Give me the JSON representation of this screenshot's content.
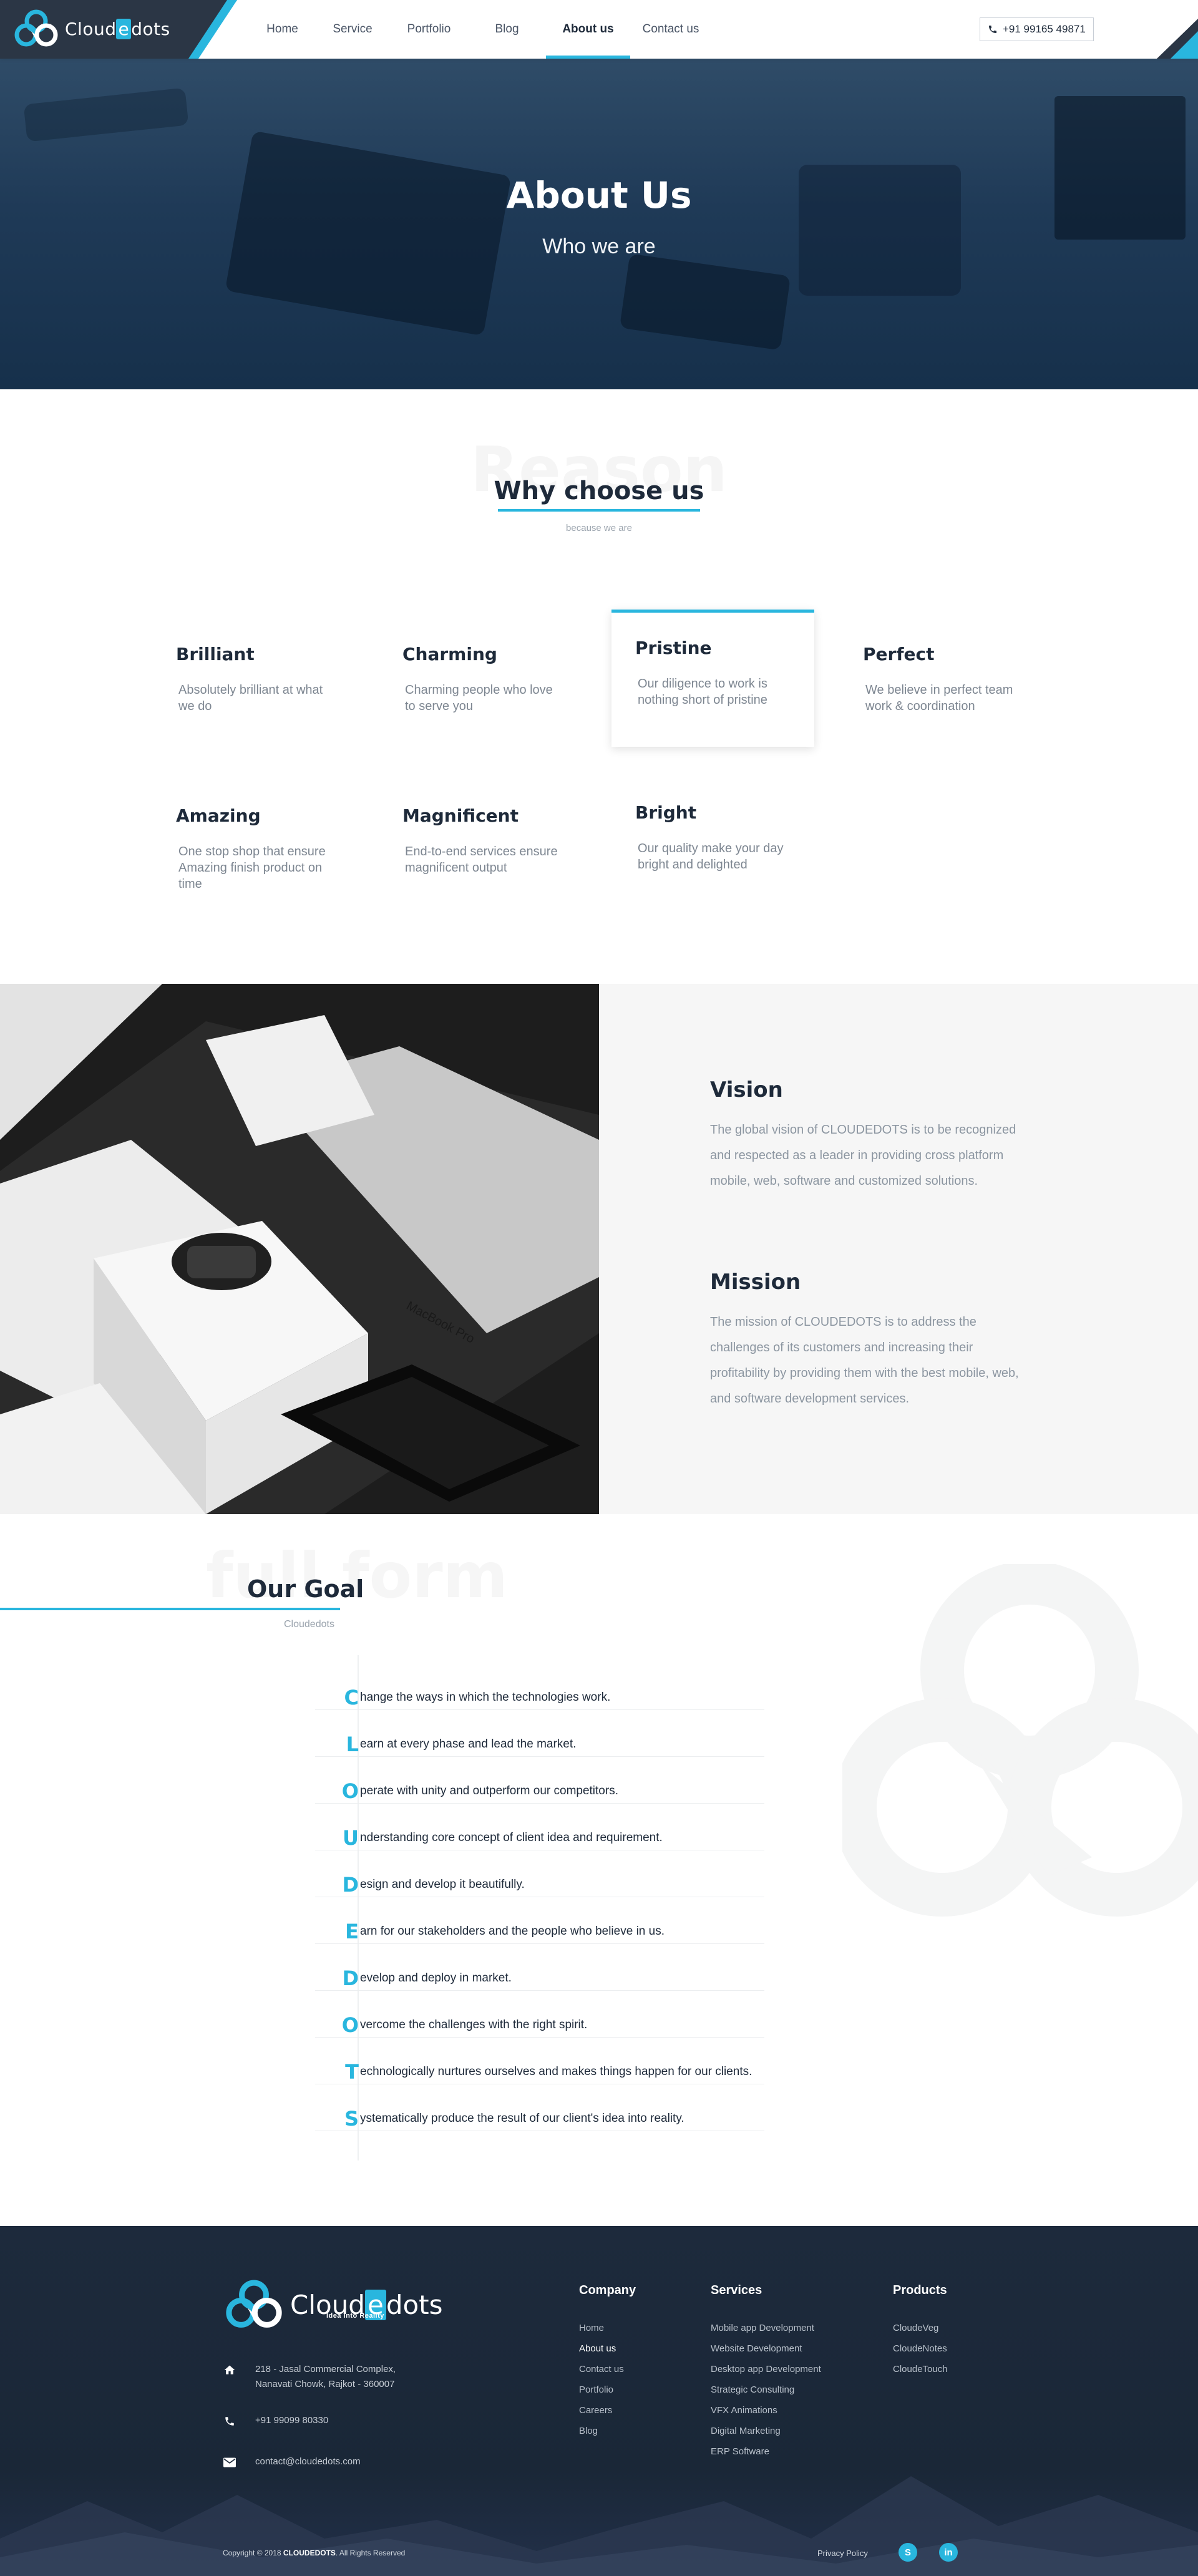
{
  "brand": {
    "logo_text_before": "Cloud",
    "logo_text_e": "e",
    "logo_text_after": "dots",
    "tagline": "Idea into Reality"
  },
  "nav": {
    "items": [
      {
        "label": "Home"
      },
      {
        "label": "Service"
      },
      {
        "label": "Portfolio"
      },
      {
        "label": "Blog"
      },
      {
        "label": "About us",
        "active": true
      },
      {
        "label": "Contact us"
      }
    ],
    "phone": "+91 99165 49871"
  },
  "hero": {
    "title": "About Us",
    "subtitle": "Who we are"
  },
  "why": {
    "bg_word": "Reason",
    "title": "Why choose us",
    "subtitle": "because we are",
    "cards": [
      {
        "title": "Brilliant",
        "text": "Absolutely brilliant at what we do"
      },
      {
        "title": "Charming",
        "text": "Charming people who love to serve you"
      },
      {
        "title": "Pristine",
        "text": "Our diligence to work is nothing short of pristine",
        "featured": true
      },
      {
        "title": "Perfect",
        "text": "We believe in perfect team work & coordination"
      },
      {
        "title": "Amazing",
        "text": "One stop shop that ensure Amazing finish product on time"
      },
      {
        "title": "Magnificent",
        "text": "End-to-end services ensure magnificent output"
      },
      {
        "title": "Bright",
        "text": "Our quality make your day bright and delighted"
      }
    ]
  },
  "vision": {
    "title": "Vision",
    "text": "The global vision of CLOUDEDOTS is to be recognized and respected as a leader in providing cross platform mobile, web, software and customized solutions."
  },
  "mission": {
    "title": "Mission",
    "text": "The mission of CLOUDEDOTS is to address the challenges of its customers and increasing their profitability by providing them with the best mobile, web, and software development services."
  },
  "goal": {
    "bg_word": "full form",
    "title": "Our Goal",
    "subtitle": "Cloudedots",
    "rows": [
      {
        "letter": "C",
        "text": "hange the ways in which the technologies work."
      },
      {
        "letter": "L",
        "text": "earn at every phase and lead the market."
      },
      {
        "letter": "O",
        "text": "perate with unity and outperform our competitors."
      },
      {
        "letter": "U",
        "text": "nderstanding core concept of client idea and requirement."
      },
      {
        "letter": "D",
        "text": "esign and develop it beautifully."
      },
      {
        "letter": "E",
        "text": "arn for our stakeholders and the people who believe in us."
      },
      {
        "letter": "D",
        "text": "evelop and deploy in market."
      },
      {
        "letter": "O",
        "text": "vercome the challenges with the right spirit."
      },
      {
        "letter": "T",
        "text": "echnologically nurtures ourselves and makes things happen for our clients."
      },
      {
        "letter": "S",
        "text": "ystematically produce the result of our client's idea into reality."
      }
    ]
  },
  "footer": {
    "address_line1": "218 - Jasal Commercial Complex,",
    "address_line2": "Nanavati Chowk, Rajkot - 360007",
    "phone": "+91 99099 80330",
    "email": "contact@cloudedots.com",
    "company": {
      "title": "Company",
      "links": [
        "Home",
        "About us",
        "Contact us",
        "Portfolio",
        "Careers",
        "Blog"
      ]
    },
    "services": {
      "title": "Services",
      "links": [
        "Mobile app Development",
        "Website Development",
        "Desktop app Development",
        "Strategic Consulting",
        "VFX Animations",
        "Digital Marketing",
        "ERP Software"
      ]
    },
    "products": {
      "title": "Products",
      "links": [
        "CloudeVeg",
        "CloudeNotes",
        "CloudeTouch"
      ]
    },
    "copyright_prefix": "Copyright © 2018",
    "copyright_brand": "CLOUDEDOTS",
    "copyright_suffix": ". All Rights Reserved",
    "privacy": "Privacy Policy",
    "social": [
      {
        "icon": "skype-icon",
        "glyph": "S"
      },
      {
        "icon": "linkedin-icon",
        "glyph": "in"
      }
    ]
  },
  "colors": {
    "accent": "#29b6de",
    "dark": "#1e2a3a",
    "footer_bg": "#1d2a3c"
  }
}
